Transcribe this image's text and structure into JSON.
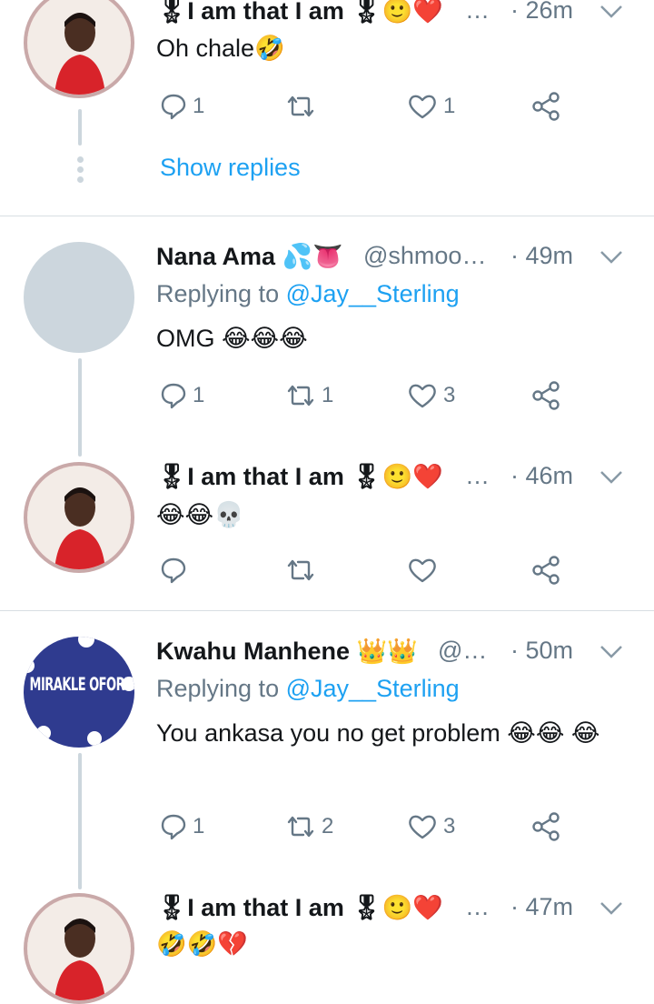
{
  "tweets": [
    {
      "name": "🎖I am that I am 🎖🙂❤️",
      "handle": "…",
      "time": "· 26m",
      "body": "Oh chale🤣",
      "actions": {
        "reply": "1",
        "retweet": "",
        "like": "1"
      },
      "show_replies": "Show replies"
    },
    {
      "name": "Nana Ama 💦👅",
      "handle": "@shmoo…",
      "time": "· 49m",
      "replying_prefix": "Replying to",
      "replying_handle": "@Jay__Sterling",
      "body": "OMG 😂😂😂",
      "actions": {
        "reply": "1",
        "retweet": "1",
        "like": "3"
      }
    },
    {
      "name": "🎖I am that I am 🎖🙂❤️",
      "handle": "…",
      "time": "· 46m",
      "body": "😂😂💀",
      "actions": {
        "reply": "",
        "retweet": "",
        "like": ""
      }
    },
    {
      "name": "Kwahu Manhene 👑👑",
      "handle": "@…",
      "time": "· 50m",
      "replying_prefix": "Replying to",
      "replying_handle": "@Jay__Sterling",
      "body": "You ankasa you no get problem 😂😂 😂",
      "avatar_text": "MIRAKLE OFORI",
      "actions": {
        "reply": "1",
        "retweet": "2",
        "like": "3"
      }
    },
    {
      "name": "🎖I am that I am 🎖🙂❤️",
      "handle": "…",
      "time": "· 47m",
      "body": "🤣🤣💔",
      "actions": {
        "reply": "",
        "retweet": "",
        "like": ""
      }
    }
  ],
  "colors": {
    "accent": "#1da1f2",
    "muted": "#657786",
    "text": "#14171a",
    "line": "#ccd6dd"
  },
  "icons": [
    "reply-icon",
    "retweet-icon",
    "like-icon",
    "share-icon",
    "chevron-down-icon"
  ]
}
